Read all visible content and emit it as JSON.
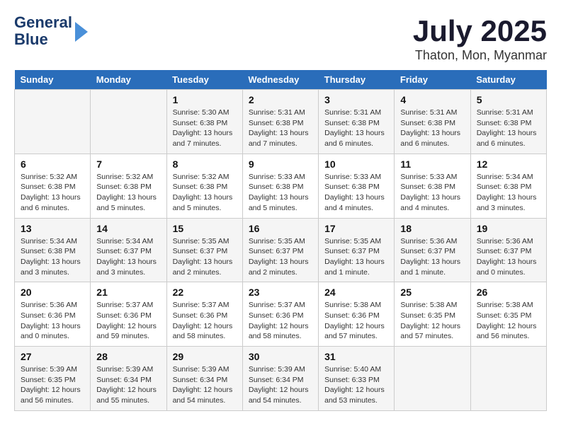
{
  "header": {
    "logo_line1": "General",
    "logo_line2": "Blue",
    "month": "July 2025",
    "location": "Thaton, Mon, Myanmar"
  },
  "weekdays": [
    "Sunday",
    "Monday",
    "Tuesday",
    "Wednesday",
    "Thursday",
    "Friday",
    "Saturday"
  ],
  "weeks": [
    [
      {
        "day": "",
        "info": ""
      },
      {
        "day": "",
        "info": ""
      },
      {
        "day": "1",
        "info": "Sunrise: 5:30 AM\nSunset: 6:38 PM\nDaylight: 13 hours and 7 minutes."
      },
      {
        "day": "2",
        "info": "Sunrise: 5:31 AM\nSunset: 6:38 PM\nDaylight: 13 hours and 7 minutes."
      },
      {
        "day": "3",
        "info": "Sunrise: 5:31 AM\nSunset: 6:38 PM\nDaylight: 13 hours and 6 minutes."
      },
      {
        "day": "4",
        "info": "Sunrise: 5:31 AM\nSunset: 6:38 PM\nDaylight: 13 hours and 6 minutes."
      },
      {
        "day": "5",
        "info": "Sunrise: 5:31 AM\nSunset: 6:38 PM\nDaylight: 13 hours and 6 minutes."
      }
    ],
    [
      {
        "day": "6",
        "info": "Sunrise: 5:32 AM\nSunset: 6:38 PM\nDaylight: 13 hours and 6 minutes."
      },
      {
        "day": "7",
        "info": "Sunrise: 5:32 AM\nSunset: 6:38 PM\nDaylight: 13 hours and 5 minutes."
      },
      {
        "day": "8",
        "info": "Sunrise: 5:32 AM\nSunset: 6:38 PM\nDaylight: 13 hours and 5 minutes."
      },
      {
        "day": "9",
        "info": "Sunrise: 5:33 AM\nSunset: 6:38 PM\nDaylight: 13 hours and 5 minutes."
      },
      {
        "day": "10",
        "info": "Sunrise: 5:33 AM\nSunset: 6:38 PM\nDaylight: 13 hours and 4 minutes."
      },
      {
        "day": "11",
        "info": "Sunrise: 5:33 AM\nSunset: 6:38 PM\nDaylight: 13 hours and 4 minutes."
      },
      {
        "day": "12",
        "info": "Sunrise: 5:34 AM\nSunset: 6:38 PM\nDaylight: 13 hours and 3 minutes."
      }
    ],
    [
      {
        "day": "13",
        "info": "Sunrise: 5:34 AM\nSunset: 6:38 PM\nDaylight: 13 hours and 3 minutes."
      },
      {
        "day": "14",
        "info": "Sunrise: 5:34 AM\nSunset: 6:37 PM\nDaylight: 13 hours and 3 minutes."
      },
      {
        "day": "15",
        "info": "Sunrise: 5:35 AM\nSunset: 6:37 PM\nDaylight: 13 hours and 2 minutes."
      },
      {
        "day": "16",
        "info": "Sunrise: 5:35 AM\nSunset: 6:37 PM\nDaylight: 13 hours and 2 minutes."
      },
      {
        "day": "17",
        "info": "Sunrise: 5:35 AM\nSunset: 6:37 PM\nDaylight: 13 hours and 1 minute."
      },
      {
        "day": "18",
        "info": "Sunrise: 5:36 AM\nSunset: 6:37 PM\nDaylight: 13 hours and 1 minute."
      },
      {
        "day": "19",
        "info": "Sunrise: 5:36 AM\nSunset: 6:37 PM\nDaylight: 13 hours and 0 minutes."
      }
    ],
    [
      {
        "day": "20",
        "info": "Sunrise: 5:36 AM\nSunset: 6:36 PM\nDaylight: 13 hours and 0 minutes."
      },
      {
        "day": "21",
        "info": "Sunrise: 5:37 AM\nSunset: 6:36 PM\nDaylight: 12 hours and 59 minutes."
      },
      {
        "day": "22",
        "info": "Sunrise: 5:37 AM\nSunset: 6:36 PM\nDaylight: 12 hours and 58 minutes."
      },
      {
        "day": "23",
        "info": "Sunrise: 5:37 AM\nSunset: 6:36 PM\nDaylight: 12 hours and 58 minutes."
      },
      {
        "day": "24",
        "info": "Sunrise: 5:38 AM\nSunset: 6:36 PM\nDaylight: 12 hours and 57 minutes."
      },
      {
        "day": "25",
        "info": "Sunrise: 5:38 AM\nSunset: 6:35 PM\nDaylight: 12 hours and 57 minutes."
      },
      {
        "day": "26",
        "info": "Sunrise: 5:38 AM\nSunset: 6:35 PM\nDaylight: 12 hours and 56 minutes."
      }
    ],
    [
      {
        "day": "27",
        "info": "Sunrise: 5:39 AM\nSunset: 6:35 PM\nDaylight: 12 hours and 56 minutes."
      },
      {
        "day": "28",
        "info": "Sunrise: 5:39 AM\nSunset: 6:34 PM\nDaylight: 12 hours and 55 minutes."
      },
      {
        "day": "29",
        "info": "Sunrise: 5:39 AM\nSunset: 6:34 PM\nDaylight: 12 hours and 54 minutes."
      },
      {
        "day": "30",
        "info": "Sunrise: 5:39 AM\nSunset: 6:34 PM\nDaylight: 12 hours and 54 minutes."
      },
      {
        "day": "31",
        "info": "Sunrise: 5:40 AM\nSunset: 6:33 PM\nDaylight: 12 hours and 53 minutes."
      },
      {
        "day": "",
        "info": ""
      },
      {
        "day": "",
        "info": ""
      }
    ]
  ]
}
